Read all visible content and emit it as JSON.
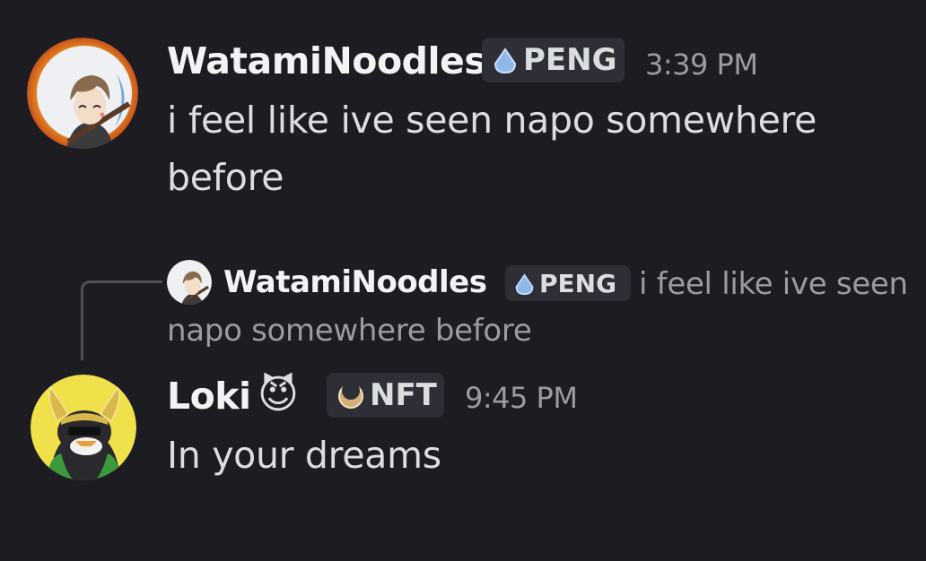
{
  "messages": [
    {
      "author": "WatamiNoodles",
      "tag": "PENG",
      "tag_icon": "droplet-icon",
      "timestamp": "3:39 PM",
      "text_line1": "i feel like ive seen napo somewhere",
      "text_line2": "before"
    },
    {
      "reply": {
        "author": "WatamiNoodles",
        "tag": "PENG",
        "tag_icon": "droplet-icon",
        "text_line1": "i feel like ive seen",
        "text_line2": "napo somewhere before"
      },
      "author": "Loki",
      "author_emoji": "😈",
      "tag": "NFT",
      "tag_icon": "crescent-icon",
      "timestamp": "9:45 PM",
      "text": "In your dreams"
    }
  ],
  "colors": {
    "background": "#1c1c22",
    "username": "#f2f3f5",
    "message_text": "#dbdee1",
    "muted_text": "#9a9ca3",
    "tag_background": "#2e2f36",
    "peng_icon": "#8fb8e8",
    "nft_icon": "#d6b07a",
    "loki_avatar_bg": "#f0e04a"
  }
}
